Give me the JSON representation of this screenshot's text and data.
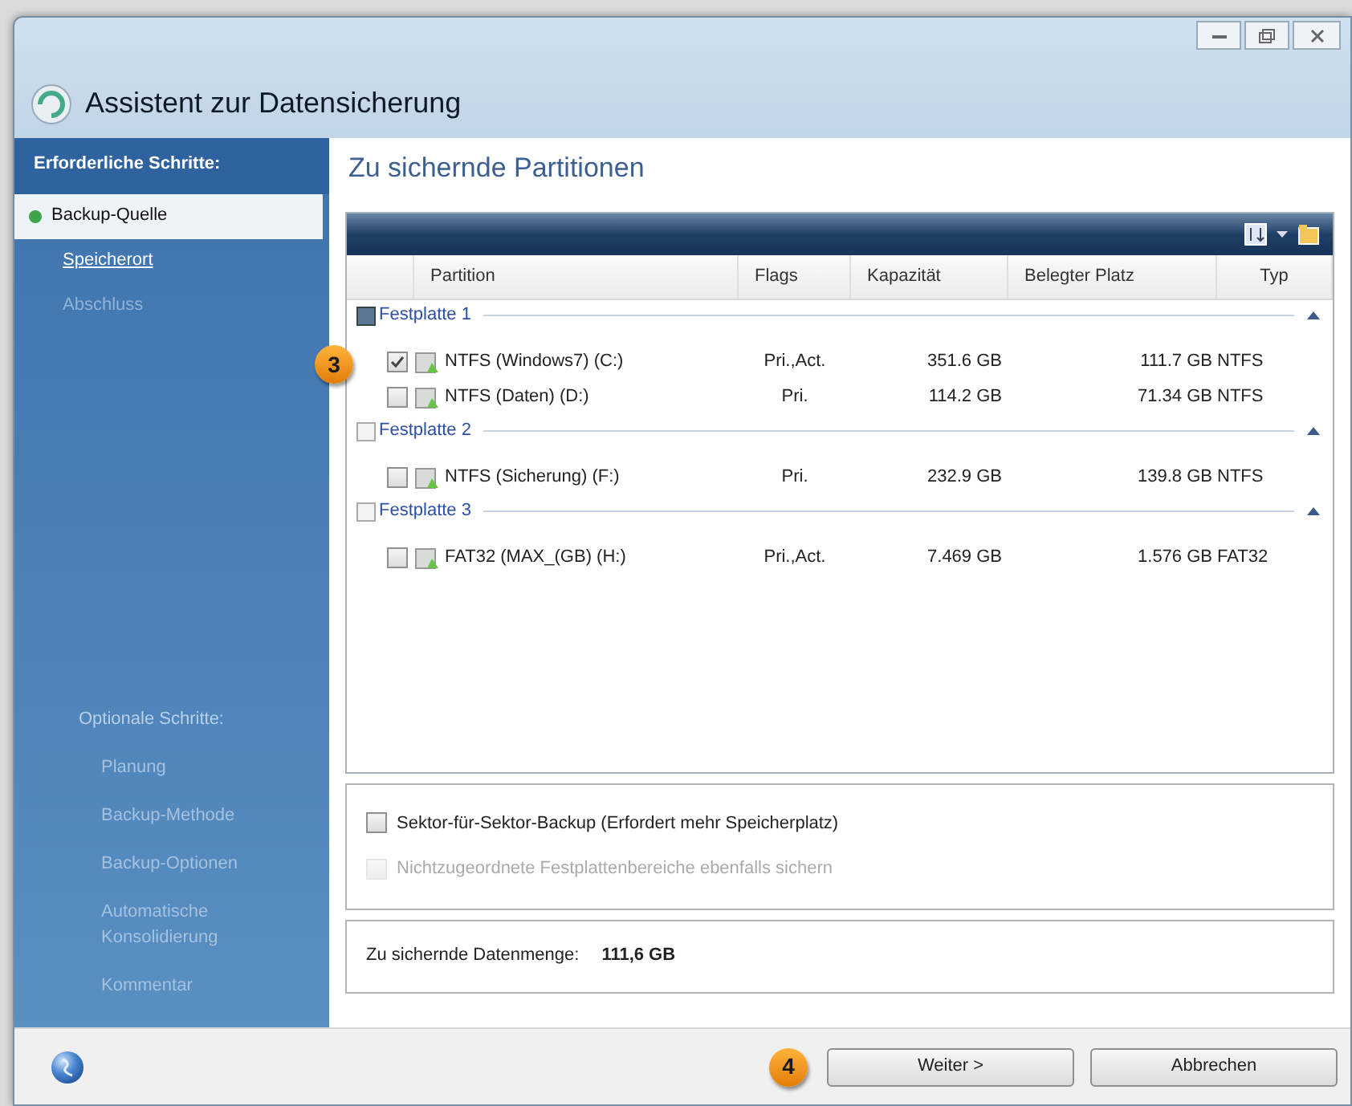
{
  "window": {
    "title": "Assistent zur Datensicherung"
  },
  "sidebar": {
    "required_heading": "Erforderliche Schritte:",
    "required_steps": [
      {
        "label": "Backup-Quelle",
        "selected": true,
        "disabled": false
      },
      {
        "label": "Speicherort",
        "selected": false,
        "disabled": false
      },
      {
        "label": "Abschluss",
        "selected": false,
        "disabled": true
      }
    ],
    "optional_heading": "Optionale Schritte:",
    "optional_steps": [
      {
        "label": "Planung"
      },
      {
        "label": "Backup-Methode"
      },
      {
        "label": "Backup-Optionen"
      },
      {
        "label": "Automatische Konsolidierung"
      },
      {
        "label": "Kommentar"
      }
    ]
  },
  "main": {
    "heading": "Zu sichernde Partitionen",
    "table": {
      "columns": [
        "Partition",
        "Flags",
        "Kapazität",
        "Belegter Platz",
        "Typ"
      ],
      "groups": [
        {
          "label": "Festplatte 1",
          "checked": true,
          "rows": [
            {
              "partition": "NTFS (Windows7) (C:)",
              "flags": "Pri.,Act.",
              "capacity": "351.6 GB",
              "used": "111.7 GB",
              "type": "NTFS",
              "checked": true,
              "callout": "3"
            },
            {
              "partition": "NTFS (Daten) (D:)",
              "flags": "Pri.",
              "capacity": "114.2 GB",
              "used": "71.34 GB",
              "type": "NTFS",
              "checked": false
            }
          ]
        },
        {
          "label": "Festplatte 2",
          "checked": false,
          "rows": [
            {
              "partition": "NTFS (Sicherung) (F:)",
              "flags": "Pri.",
              "capacity": "232.9 GB",
              "used": "139.8 GB",
              "type": "NTFS",
              "checked": false
            }
          ]
        },
        {
          "label": "Festplatte 3",
          "checked": false,
          "rows": [
            {
              "partition": "FAT32 (MAX_(GB) (H:)",
              "flags": "Pri.,Act.",
              "capacity": "7.469 GB",
              "used": "1.576 GB",
              "type": "FAT32",
              "checked": false
            }
          ]
        }
      ]
    },
    "options": [
      {
        "label": "Sektor-für-Sektor-Backup (Erfordert mehr Speicherplatz)",
        "checked": false,
        "disabled": false
      },
      {
        "label": "Nichtzugeordnete Festplattenbereiche ebenfalls sichern",
        "checked": false,
        "disabled": true
      }
    ],
    "summary": {
      "label": "Zu sichernde Datenmenge:",
      "value": "111,6 GB"
    }
  },
  "footer": {
    "callout": "4",
    "buttons": [
      {
        "label": "Weiter >"
      },
      {
        "label": "Abbrechen"
      }
    ]
  }
}
